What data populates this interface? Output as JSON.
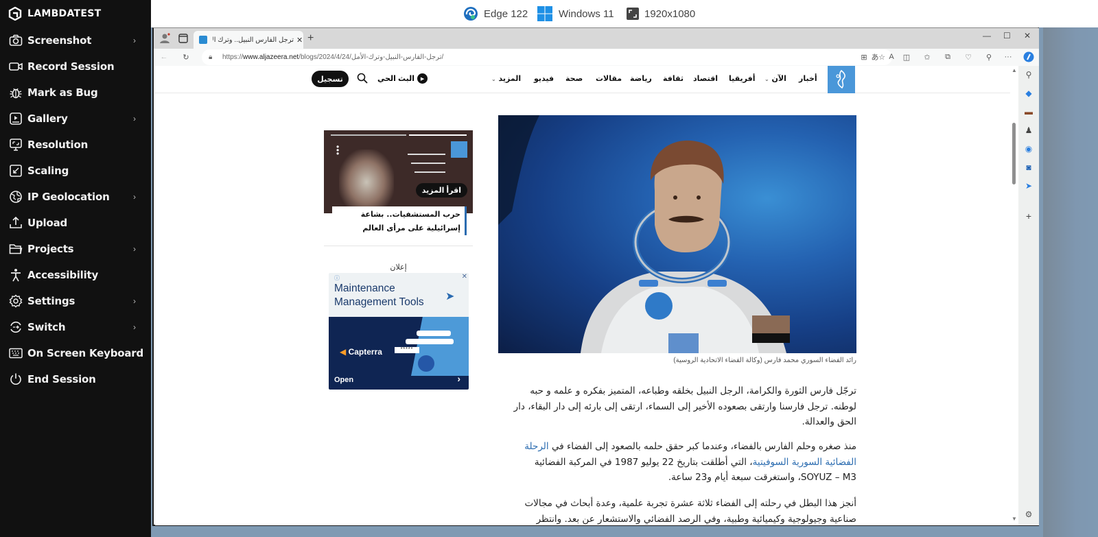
{
  "sidebar": {
    "brand": "LAMBDATEST",
    "items": [
      {
        "label": "Screenshot",
        "icon": "camera-icon",
        "has_submenu": true
      },
      {
        "label": "Record Session",
        "icon": "video-camera-icon",
        "has_submenu": false
      },
      {
        "label": "Mark as Bug",
        "icon": "bug-icon",
        "has_submenu": false
      },
      {
        "label": "Gallery",
        "icon": "gallery-icon",
        "has_submenu": true
      },
      {
        "label": "Resolution",
        "icon": "monitor-icon",
        "has_submenu": false
      },
      {
        "label": "Scaling",
        "icon": "scaling-icon",
        "has_submenu": false
      },
      {
        "label": "IP Geolocation",
        "icon": "globe-icon",
        "has_submenu": true
      },
      {
        "label": "Upload",
        "icon": "upload-icon",
        "has_submenu": false
      },
      {
        "label": "Projects",
        "icon": "folder-icon",
        "has_submenu": true
      },
      {
        "label": "Accessibility",
        "icon": "accessibility-icon",
        "has_submenu": false
      },
      {
        "label": "Settings",
        "icon": "gear-icon",
        "has_submenu": true
      },
      {
        "label": "Switch",
        "icon": "switch-icon",
        "has_submenu": true
      },
      {
        "label": "On Screen Keyboard",
        "icon": "keyboard-icon",
        "has_submenu": false
      },
      {
        "label": "End Session",
        "icon": "power-icon",
        "has_submenu": false
      }
    ]
  },
  "session_info": {
    "browser": "Edge 122",
    "os": "Windows 11",
    "resolution": "1920x1080"
  },
  "browser": {
    "tab_title": "ترجل الفارس النبيل.. وترك الأمل | ال",
    "url_prefix": "https://",
    "url_domain": "www.aljazeera.net",
    "url_path": "/blogs/2024/4/24/ترجل-الفارس-النبيل-وترك-الأمل/"
  },
  "site": {
    "nav": [
      "أخبار",
      "الآن",
      "أفريقيا",
      "اقتصاد",
      "ثقافة",
      "رياضة",
      "مقالات",
      "صحة",
      "فيديو",
      "المزيد"
    ],
    "live_label": "البث الحي",
    "signup_label": "تسجيل"
  },
  "article": {
    "image_caption": "رائد الفضاء السوري محمد فارس (وكالة الفضاء الاتحادية الروسية)",
    "paragraphs": [
      {
        "text": "ترجّل فارس الثورة والكرامة، الرجل النبيل بخلقه وطباعه، المتميز بفكره و علمه و حبه لوطنه. ترجل فارسنا وارتقى بصعوده الأخير إلى السماء، ارتقى إلى بارئه إلى دار البقاء، دار الحق والعدالة."
      },
      {
        "before": "منذ صغره وحلم الفارس بالفضاء، وعندما كبر حقق حلمه بالصعود إلى الفضاء في ",
        "link": "الرحلة الفضائية السورية السوفيتية",
        "after": "، التي أطلقت بتاريخ 22 يوليو 1987 في المركبة الفضائية SOYUZ – M3، واستغرقت سبعة أيام و23 ساعة."
      },
      {
        "text": "أنجز هذا البطل في رحلته إلى الفضاء ثلاثة عشرة تجربة علمية، وعدة أبحاث في مجالات صناعية وجيولوجية وكيميائية وطبية، وفي الرصد الفضائي والاستشعار عن بعد. وانتظر"
      }
    ]
  },
  "promo": {
    "read_more": "اقرأ المزيد",
    "title": "حرب المستشفيات.. بشاعة إسرائيلية على مرأى العالم"
  },
  "ad": {
    "label": "إعلان",
    "headline": "Maintenance Management Tools",
    "brand": "Capterra",
    "cta": "Open"
  }
}
